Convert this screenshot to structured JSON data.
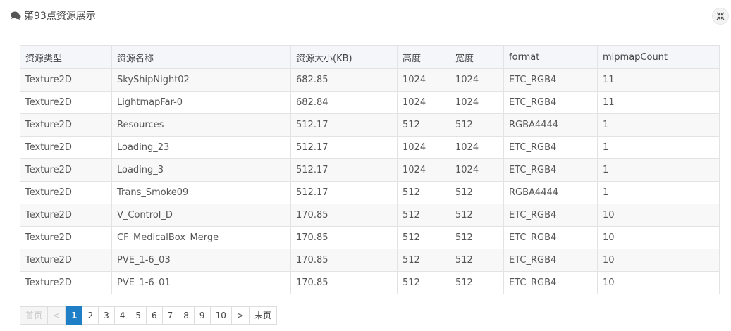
{
  "header": {
    "title": "第93点资源展示"
  },
  "table": {
    "columns": [
      "资源类型",
      "资源名称",
      "资源大小(KB)",
      "高度",
      "宽度",
      "format",
      "mipmapCount"
    ],
    "rows": [
      [
        "Texture2D",
        "SkyShipNight02",
        "682.85",
        "1024",
        "1024",
        "ETC_RGB4",
        "11"
      ],
      [
        "Texture2D",
        "LightmapFar-0",
        "682.84",
        "1024",
        "1024",
        "ETC_RGB4",
        "11"
      ],
      [
        "Texture2D",
        "Resources",
        "512.17",
        "512",
        "512",
        "RGBA4444",
        "1"
      ],
      [
        "Texture2D",
        "Loading_23",
        "512.17",
        "1024",
        "1024",
        "ETC_RGB4",
        "1"
      ],
      [
        "Texture2D",
        "Loading_3",
        "512.17",
        "1024",
        "1024",
        "ETC_RGB4",
        "1"
      ],
      [
        "Texture2D",
        "Trans_Smoke09",
        "512.17",
        "512",
        "512",
        "RGBA4444",
        "1"
      ],
      [
        "Texture2D",
        "V_Control_D",
        "170.85",
        "512",
        "512",
        "ETC_RGB4",
        "10"
      ],
      [
        "Texture2D",
        "CF_MedicalBox_Merge",
        "170.85",
        "512",
        "512",
        "ETC_RGB4",
        "10"
      ],
      [
        "Texture2D",
        "PVE_1-6_03",
        "170.85",
        "512",
        "512",
        "ETC_RGB4",
        "10"
      ],
      [
        "Texture2D",
        "PVE_1-6_01",
        "170.85",
        "512",
        "512",
        "ETC_RGB4",
        "10"
      ]
    ]
  },
  "pagination": {
    "first_label": "首页",
    "prev_label": "<",
    "pages": [
      "1",
      "2",
      "3",
      "4",
      "5",
      "6",
      "7",
      "8",
      "9",
      "10"
    ],
    "current_page": "1",
    "next_label": ">",
    "last_label": "末页"
  },
  "icons": {
    "title_icon": "comments-icon",
    "window_button_icon": "compress-icon"
  },
  "colors": {
    "active_page": "#1e7fc6",
    "header_row_bg": "#f4f6f9",
    "striped_row_bg": "#f8f8f8"
  }
}
